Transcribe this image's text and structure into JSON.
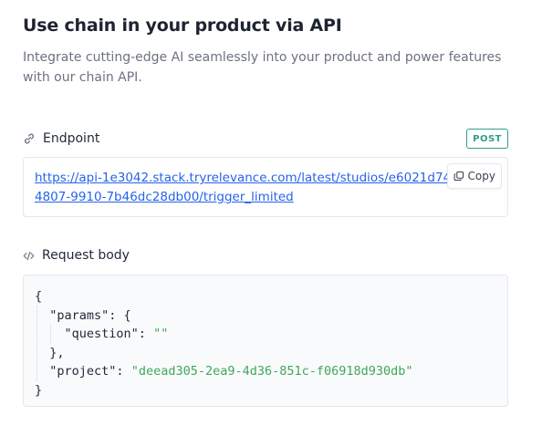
{
  "header": {
    "title": "Use chain in your product via API",
    "subtitle": "Integrate cutting-edge AI seamlessly into your product and power features with our chain API."
  },
  "endpoint": {
    "label": "Endpoint",
    "icon": "link-icon",
    "method": "POST",
    "url": "https://api-1e3042.stack.tryrelevance.com/latest/studios/e6021d74-d4807-9910-7b46dc28db00/trigger_limited",
    "copy_label": "Copy",
    "copy_icon": "copy-icon"
  },
  "request_body": {
    "label": "Request body",
    "icon": "code-icon",
    "lines": {
      "l1": "{",
      "l2_key": "\"params\"",
      "l2_rest": ": {",
      "l3_key": "\"question\"",
      "l3_sep": ": ",
      "l3_val": "\"\"",
      "l4": "},",
      "l5_key": "\"project\"",
      "l5_sep": ": ",
      "l5_val": "\"deead305-2ea9-4d36-851c-f06918d930db\"",
      "l6": "}"
    }
  },
  "colors": {
    "accent_teal": "#2f9e8a",
    "link_blue": "#2563eb",
    "string_green": "#3fa85b"
  }
}
